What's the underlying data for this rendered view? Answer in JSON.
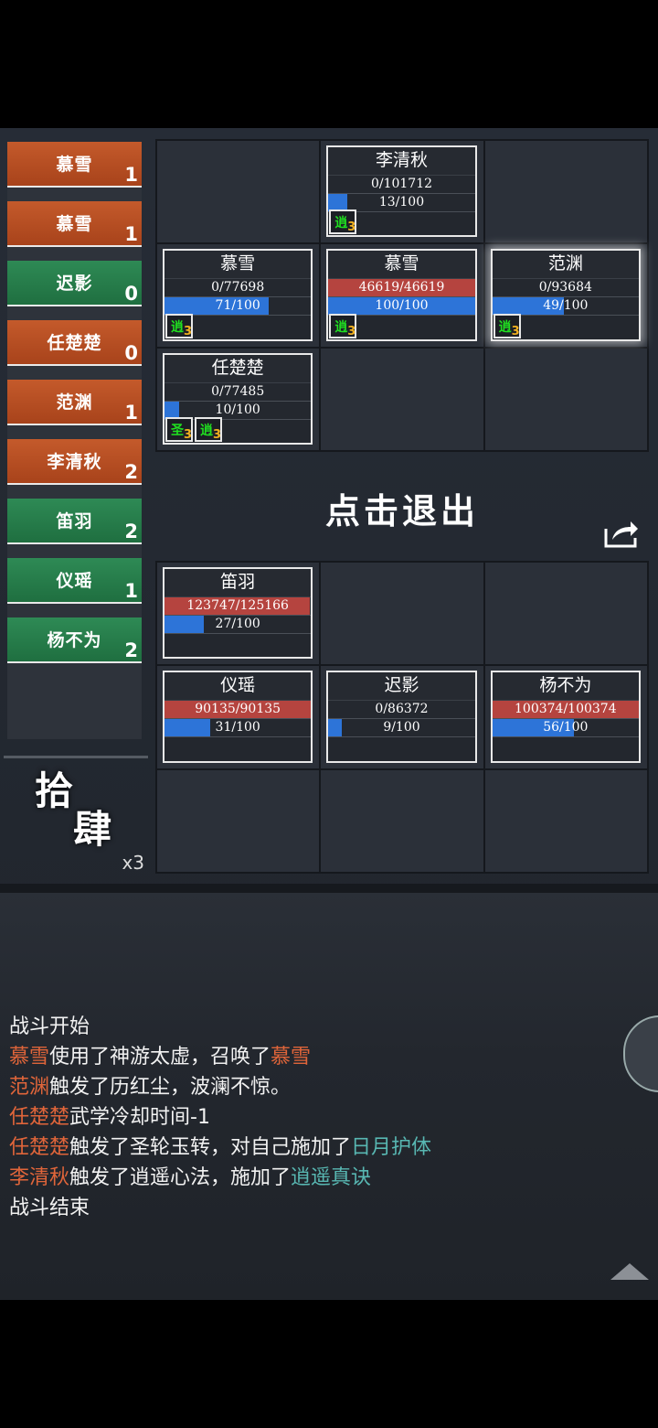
{
  "turn_order": [
    {
      "name": "慕雪",
      "count": "1",
      "team": "orange"
    },
    {
      "name": "慕雪",
      "count": "1",
      "team": "orange"
    },
    {
      "name": "迟影",
      "count": "0",
      "team": "green"
    },
    {
      "name": "任楚楚",
      "count": "0",
      "team": "orange"
    },
    {
      "name": "范渊",
      "count": "1",
      "team": "orange"
    },
    {
      "name": "李清秋",
      "count": "2",
      "team": "orange"
    },
    {
      "name": "笛羽",
      "count": "2",
      "team": "green"
    },
    {
      "name": "仪瑶",
      "count": "1",
      "team": "green"
    },
    {
      "name": "杨不为",
      "count": "2",
      "team": "green"
    }
  ],
  "skill": {
    "chars_1": "拾",
    "chars_2": "肆",
    "multiplier": "x3"
  },
  "exit_label": "点击退出",
  "top_grid": [
    null,
    {
      "name": "李清秋",
      "hp": "0/101712",
      "hp_frac": 0,
      "mp": "13/100",
      "mp_frac": 0.13,
      "buffs": [
        {
          "char": "逍",
          "stack": "3"
        }
      ]
    },
    null,
    {
      "name": "慕雪",
      "hp": "0/77698",
      "hp_frac": 0,
      "mp": "71/100",
      "mp_frac": 0.71,
      "buffs": [
        {
          "char": "逍",
          "stack": "3"
        }
      ]
    },
    {
      "name": "慕雪",
      "hp": "46619/46619",
      "hp_frac": 1,
      "mp": "100/100",
      "mp_frac": 1,
      "buffs": [
        {
          "char": "逍",
          "stack": "3"
        }
      ]
    },
    {
      "name": "范渊",
      "hp": "0/93684",
      "hp_frac": 0,
      "mp": "49/100",
      "mp_frac": 0.49,
      "buffs": [
        {
          "char": "逍",
          "stack": "3"
        }
      ],
      "selected": true
    },
    {
      "name": "任楚楚",
      "hp": "0/77485",
      "hp_frac": 0,
      "mp": "10/100",
      "mp_frac": 0.1,
      "buffs": [
        {
          "char": "圣",
          "stack": "3"
        },
        {
          "char": "逍",
          "stack": "3"
        }
      ]
    },
    null,
    null
  ],
  "bottom_grid": [
    {
      "name": "笛羽",
      "hp": "123747/125166",
      "hp_frac": 0.99,
      "mp": "27/100",
      "mp_frac": 0.27,
      "buffs": []
    },
    null,
    null,
    {
      "name": "仪瑶",
      "hp": "90135/90135",
      "hp_frac": 1,
      "mp": "31/100",
      "mp_frac": 0.31,
      "buffs": []
    },
    {
      "name": "迟影",
      "hp": "0/86372",
      "hp_frac": 0,
      "mp": "9/100",
      "mp_frac": 0.09,
      "buffs": []
    },
    {
      "name": "杨不为",
      "hp": "100374/100374",
      "hp_frac": 1,
      "mp": "56/100",
      "mp_frac": 0.56,
      "buffs": []
    },
    null,
    null,
    null
  ],
  "log": [
    [
      {
        "t": "战斗开始"
      }
    ],
    [
      {
        "t": "慕雪",
        "c": "o"
      },
      {
        "t": "使用了神游太虚，召唤了"
      },
      {
        "t": "慕雪",
        "c": "o"
      }
    ],
    [
      {
        "t": "范渊",
        "c": "o"
      },
      {
        "t": "触发了历红尘，波澜不惊。"
      }
    ],
    [
      {
        "t": "任楚楚",
        "c": "o"
      },
      {
        "t": "武学冷却时间-1"
      }
    ],
    [
      {
        "t": "任楚楚",
        "c": "o"
      },
      {
        "t": "触发了圣轮玉转，对自己施加了"
      },
      {
        "t": "日月护体",
        "c": "c"
      }
    ],
    [
      {
        "t": "李清秋",
        "c": "o"
      },
      {
        "t": "触发了逍遥心法，施加了"
      },
      {
        "t": "逍遥真诀",
        "c": "c"
      }
    ],
    [
      {
        "t": "战斗结束"
      }
    ]
  ],
  "colors": {
    "orange": "#c45a2b",
    "green": "#2e8a55",
    "hp": "#b5443f",
    "mp": "#2d74d8",
    "highlight_name": "#e0653a",
    "highlight_buff": "#58b7b2"
  },
  "icons": {
    "share": "share-icon",
    "scroll": "scroll-up-icon"
  }
}
